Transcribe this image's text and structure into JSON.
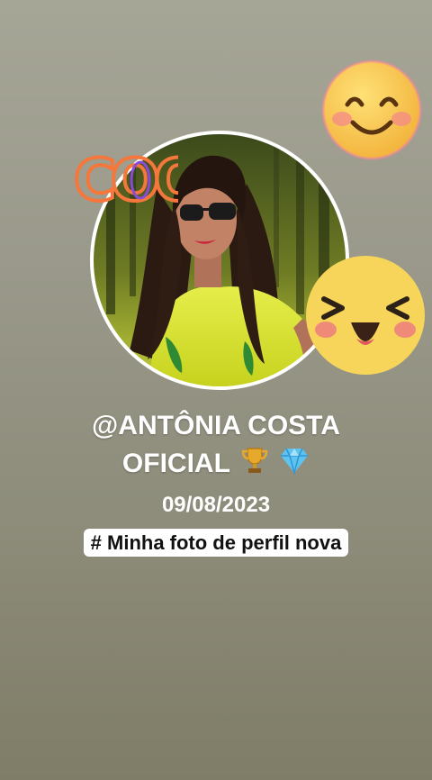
{
  "story": {
    "username_line1": "@ANTÔNIA COSTA",
    "username_line2": "OFICIAL",
    "badges": [
      "trophy-icon",
      "gem-icon"
    ],
    "date": "09/08/2023",
    "caption": "# Minha foto de perfil nova",
    "sticker_text": "COOL"
  },
  "colors": {
    "background": "#99988a",
    "text": "#ffffff",
    "caption_bg": "#ffffff",
    "emoji_yellow": "#f7d55a",
    "sticker_orange": "#f5773b",
    "sticker_purple": "#8a4bd8"
  }
}
